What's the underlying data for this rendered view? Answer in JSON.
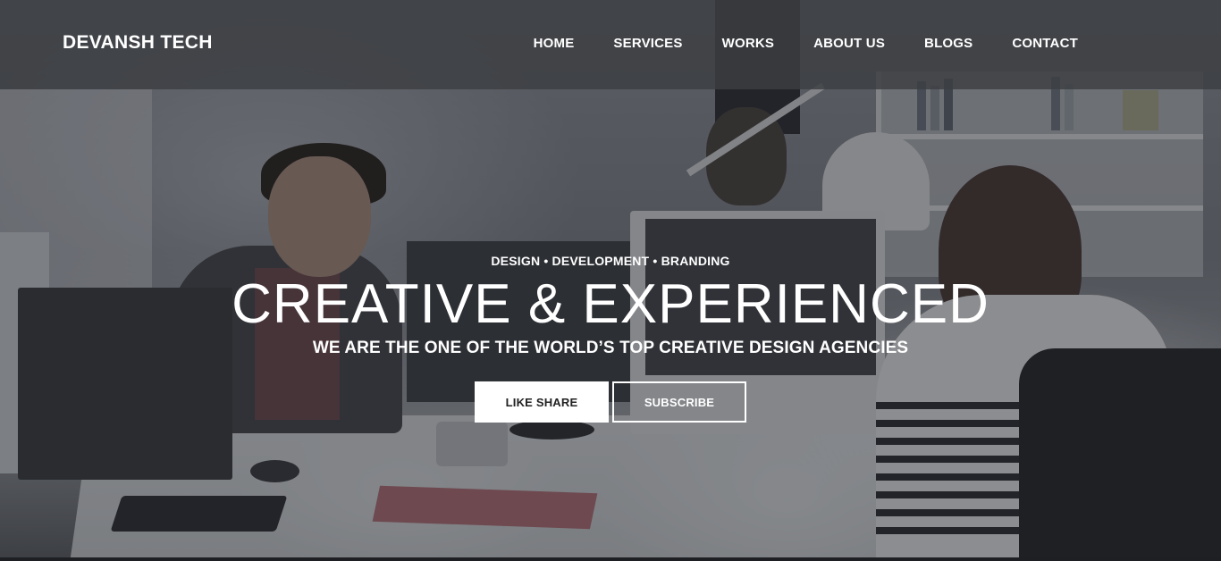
{
  "header": {
    "brand": "DEVANSH TECH",
    "nav": [
      "HOME",
      "SERVICES",
      "WORKS",
      "ABOUT US",
      "BLOGS",
      "CONTACT"
    ]
  },
  "hero": {
    "tagline": "DESIGN • DEVELOPMENT • BRANDING",
    "headline": "CREATIVE & EXPERIENCED",
    "subheadline": "WE ARE THE ONE OF THE WORLD’S TOP CREATIVE DESIGN AGENCIES",
    "buttons": {
      "primary": "LIKE SHARE",
      "secondary": "SUBSCRIBE"
    }
  },
  "colors": {
    "navbar": "#3c3e42",
    "text": "#ffffff"
  }
}
